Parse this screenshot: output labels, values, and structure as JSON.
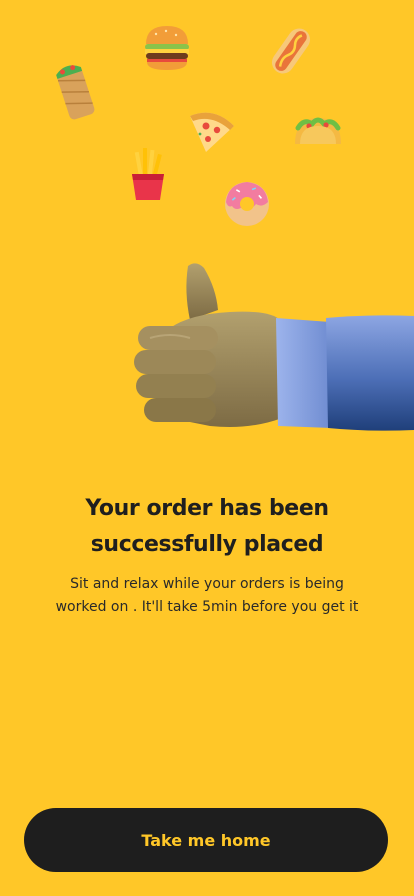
{
  "confirmation": {
    "title_line1": "Your order has been",
    "title_line2": "successfully placed",
    "message_line1": "Sit and relax while your orders is being",
    "message_line2": "worked on . It'll take 5min before you get it"
  },
  "actions": {
    "home_button_label": "Take me home"
  },
  "colors": {
    "background": "#FFC728",
    "button_background": "#1E1E1E",
    "button_text": "#FFC728",
    "heading_text": "#1F1F1F"
  },
  "icons": [
    "burger-icon",
    "hotdog-icon",
    "burrito-icon",
    "pizza-slice-icon",
    "taco-icon",
    "fries-icon",
    "donut-icon",
    "thumbs-up-illustration"
  ]
}
